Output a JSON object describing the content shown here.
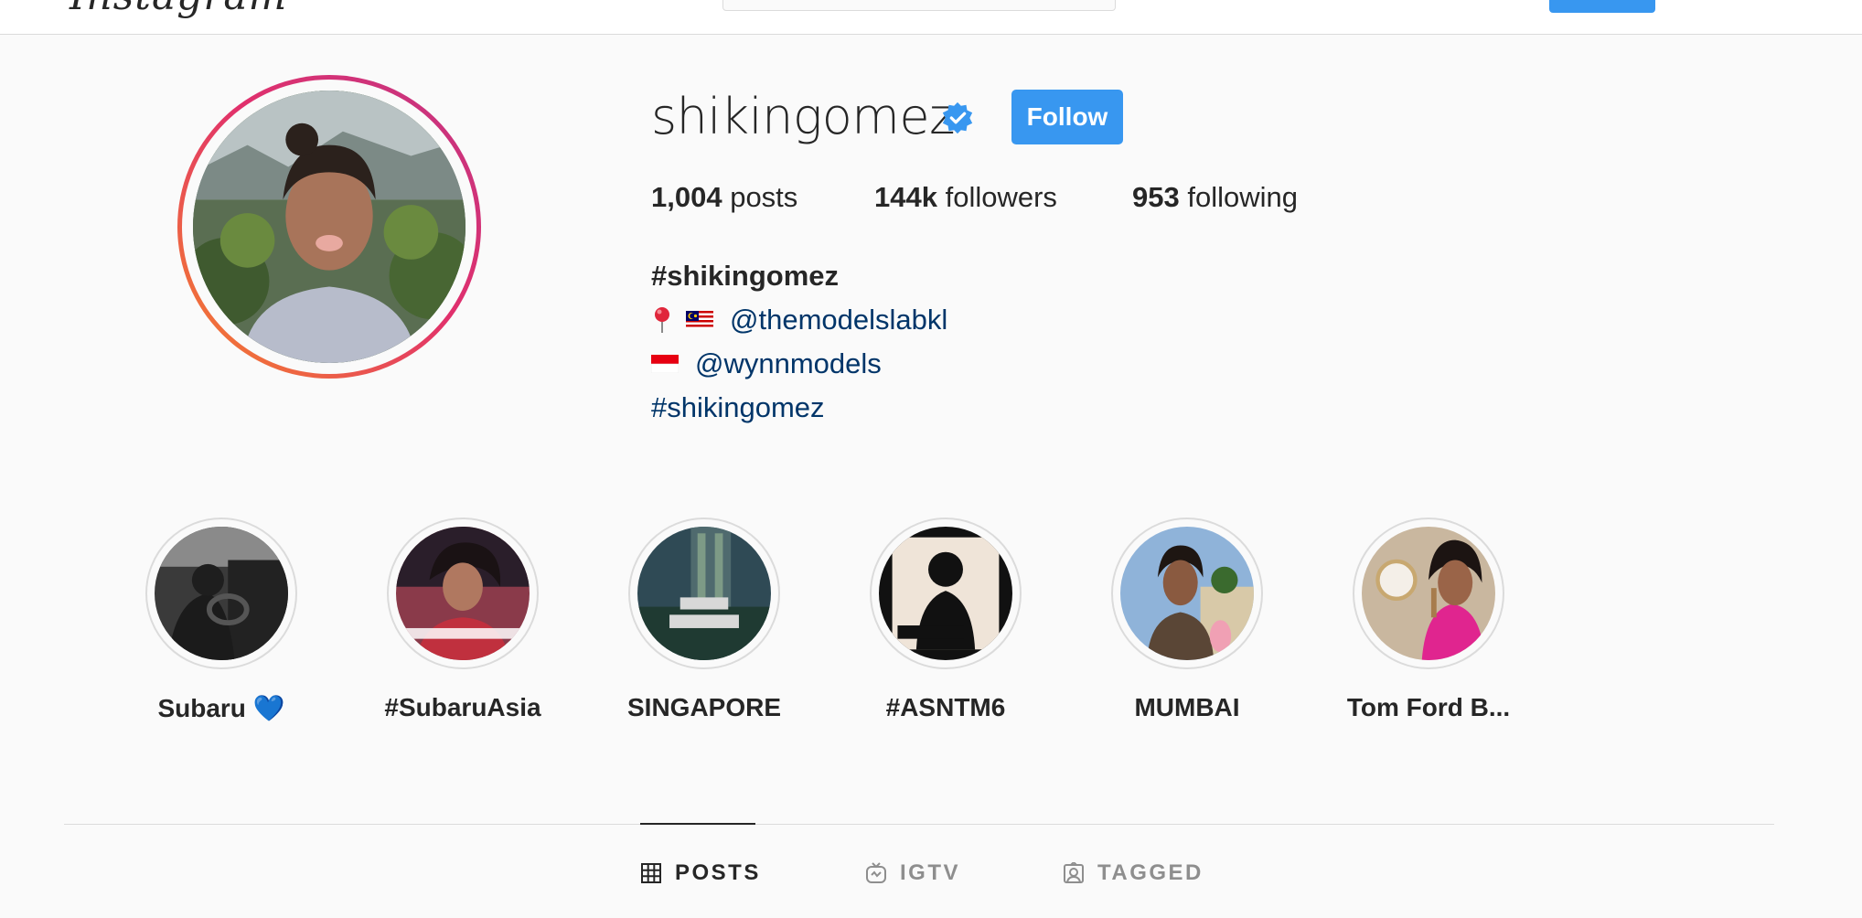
{
  "app": {
    "logo_text": "Instagram"
  },
  "profile": {
    "username": "shikingomez",
    "verified": true,
    "follow_label": "Follow",
    "stats": {
      "posts_count": "1,004",
      "posts_label": "posts",
      "followers_count": "144k",
      "followers_label": "followers",
      "following_count": "953",
      "following_label": "following"
    },
    "bio": {
      "name": "#shikingomez",
      "line1_mention": "@themodelslabkl",
      "line2_mention": "@wynnmodels",
      "line3_hashtag": "#shikingomez"
    }
  },
  "highlights": [
    {
      "label": "Subaru 💙"
    },
    {
      "label": "#SubaruAsia"
    },
    {
      "label": "SINGAPORE"
    },
    {
      "label": "#ASNTM6"
    },
    {
      "label": "MUMBAI"
    },
    {
      "label": "Tom Ford B..."
    }
  ],
  "tabs": [
    {
      "label": "POSTS",
      "icon": "grid-icon",
      "active": true
    },
    {
      "label": "IGTV",
      "icon": "igtv-icon",
      "active": false
    },
    {
      "label": "TAGGED",
      "icon": "tagged-icon",
      "active": false
    }
  ],
  "colors": {
    "accent": "#3897f0",
    "link": "#003569",
    "text": "#262626",
    "muted": "#8e8e8e",
    "background": "#fafafa"
  }
}
